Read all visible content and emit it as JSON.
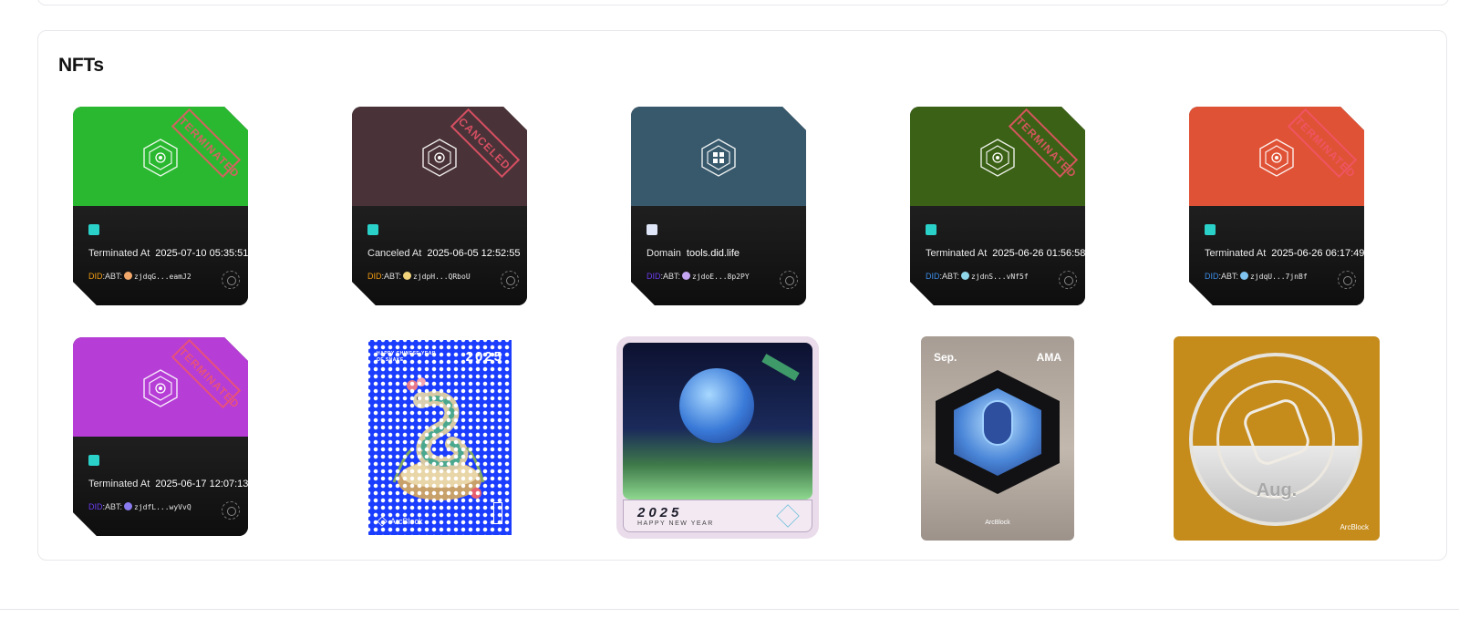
{
  "section": {
    "title": "NFTs"
  },
  "colors": {
    "accent_did_orange": "#f39c12",
    "accent_did_purple": "#6b3cf0",
    "accent_did_blue": "#3b8eea",
    "stamp_red": "#f0556a"
  },
  "passport_cards": [
    {
      "status_stamp": "TERMINATED",
      "top_color": "#2ab830",
      "app_icon": "passport-app-icon",
      "label": "Terminated At",
      "value": "2025-07-10 05:35:51",
      "did_prefix": "DID",
      "did_scheme": ":ABT:",
      "did_addr": "zjdqG...eamJ2",
      "did_color": "#f39c12",
      "mini_color": "#f2a86b"
    },
    {
      "status_stamp": "CANCELED",
      "top_color": "#4a3338",
      "app_icon": "passport-app-icon",
      "label": "Canceled At",
      "value": "2025-06-05 12:52:55",
      "did_prefix": "DID",
      "did_scheme": ":ABT:",
      "did_addr": "zjdpH...QRboU",
      "did_color": "#f39c12",
      "mini_color": "#f0d37a"
    },
    {
      "status_stamp": "",
      "top_color": "#38596c",
      "app_icon": "domain-app-icon",
      "label": "Domain",
      "value": "tools.did.life",
      "did_prefix": "DID",
      "did_scheme": ":ABT:",
      "did_addr": "zjdoE...8p2PY",
      "did_color": "#6b3cf0",
      "mini_color": "#c5a6f2"
    },
    {
      "status_stamp": "TERMINATED",
      "top_color": "#3a6115",
      "app_icon": "passport-app-icon",
      "label": "Terminated At",
      "value": "2025-06-26 01:56:58",
      "did_prefix": "DID",
      "did_scheme": ":ABT:",
      "did_addr": "zjdnS...vNf5f",
      "did_color": "#3b8eea",
      "mini_color": "#8fd6e8"
    },
    {
      "status_stamp": "TERMINATED",
      "top_color": "#e05236",
      "app_icon": "passport-app-icon",
      "label": "Terminated At",
      "value": "2025-06-26 06:17:49",
      "did_prefix": "DID",
      "did_scheme": ":ABT:",
      "did_addr": "zjdqU...7jnBf",
      "did_color": "#3b8eea",
      "mini_color": "#7fc4f0"
    },
    {
      "status_stamp": "TERMINATED",
      "top_color": "#b63ed6",
      "app_icon": "passport-app-icon",
      "label": "Terminated At",
      "value": "2025-06-17 12:07:13",
      "did_prefix": "DID",
      "did_scheme": ":ABT:",
      "did_addr": "zjdfL...wyVvQ",
      "did_color": "#6b3cf0",
      "mini_color": "#8a7cf0"
    }
  ],
  "image_cards": {
    "snake_stamp": {
      "header": "HAPPY CHINESE YEAR OF SNAKE",
      "year": "2025",
      "brand": "ArcBlock"
    },
    "new_year": {
      "year": "2025",
      "subtitle": "HAPPY NEW YEAR"
    },
    "ama": {
      "month": "Sep.",
      "tag": "AMA",
      "brand": "ArcBlock"
    },
    "aug": {
      "month": "Aug.",
      "brand": "ArcBlock"
    }
  }
}
